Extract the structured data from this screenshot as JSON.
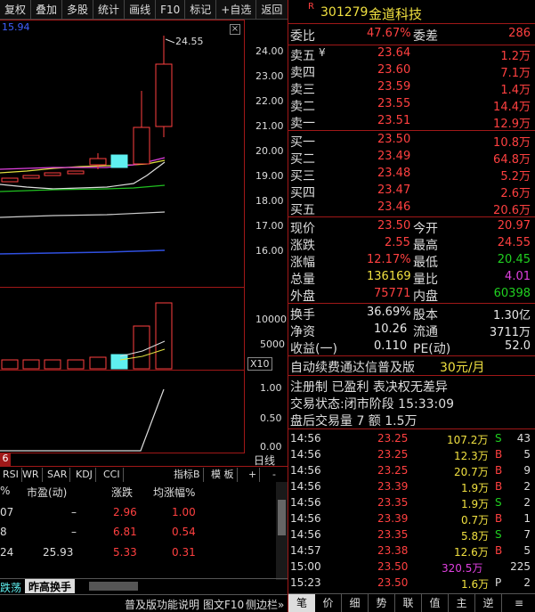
{
  "toolbar": [
    "复权",
    "叠加",
    "多股",
    "统计",
    "画线",
    "F10",
    "标记",
    "+自选",
    "返回"
  ],
  "chart": {
    "price_hint": "15.94",
    "peak_label": "24.55",
    "price_ticks": [
      "24.00",
      "23.00",
      "22.00",
      "21.00",
      "20.00",
      "19.00",
      "18.00",
      "17.00",
      "16.00"
    ],
    "vol_ticks": [
      "10000",
      "5000"
    ],
    "vol_unit": "X10",
    "ind_ticks": [
      "1.00",
      "0.50",
      "0.00"
    ],
    "date_label": "6",
    "period_label": "日线"
  },
  "indicator_tabs": [
    "RSI",
    "WR",
    "SAR",
    "KDJ",
    "CCI"
  ],
  "indicator_btns": [
    "指标B",
    "模 板",
    "+",
    "-"
  ],
  "sub_table": {
    "headers": [
      "%",
      "市盈(动)",
      "涨跌",
      "均涨幅%"
    ],
    "rows": [
      [
        "07",
        "–",
        "2.96",
        "1.00"
      ],
      [
        "8",
        "–",
        "6.81",
        "0.54"
      ],
      [
        "24",
        "25.93",
        "5.33",
        "0.31"
      ]
    ]
  },
  "bottom_tabs": [
    "跌荡",
    "昨高换手"
  ],
  "status_bar": [
    "普及版功能说明",
    "图文F10",
    "侧边栏»"
  ],
  "stock": {
    "badge": "R",
    "code": "301279",
    "name": "金道科技"
  },
  "wei": {
    "wb_label": "委比",
    "wb": "47.67%",
    "wc_label": "委差",
    "wc": "286"
  },
  "asks": [
    {
      "label": "卖五",
      "price": "23.64",
      "vol": "1.2万"
    },
    {
      "label": "卖四",
      "price": "23.60",
      "vol": "7.1万"
    },
    {
      "label": "卖三",
      "price": "23.59",
      "vol": "1.4万"
    },
    {
      "label": "卖二",
      "price": "23.55",
      "vol": "14.4万"
    },
    {
      "label": "卖一",
      "price": "23.51",
      "vol": "12.9万"
    }
  ],
  "bids": [
    {
      "label": "买一",
      "price": "23.50",
      "vol": "10.8万"
    },
    {
      "label": "买二",
      "price": "23.49",
      "vol": "64.8万"
    },
    {
      "label": "买三",
      "price": "23.48",
      "vol": "5.2万"
    },
    {
      "label": "买四",
      "price": "23.47",
      "vol": "2.6万"
    },
    {
      "label": "买五",
      "price": "23.46",
      "vol": "20.6万"
    }
  ],
  "quote": [
    {
      "l1": "现价",
      "v1": "23.50",
      "l2": "今开",
      "v2": "20.97"
    },
    {
      "l1": "涨跌",
      "v1": "2.55",
      "l2": "最高",
      "v2": "24.55"
    },
    {
      "l1": "涨幅",
      "v1": "12.17%",
      "l2": "最低",
      "v2": "20.45"
    },
    {
      "l1": "总量",
      "v1": "136169",
      "l2": "量比",
      "v2": "4.01"
    },
    {
      "l1": "外盘",
      "v1": "75771",
      "l2": "内盘",
      "v2": "60398"
    }
  ],
  "extra": [
    {
      "l1": "换手",
      "v1": "36.69%",
      "l2": "股本",
      "v2": "1.30亿"
    },
    {
      "l1": "净资",
      "v1": "10.26",
      "l2": "流通",
      "v2": "3711万"
    },
    {
      "l1": "收益(一)",
      "v1": "0.110",
      "l2": "PE(动)",
      "v2": "52.0"
    }
  ],
  "notice": {
    "text": "自动续费通达信普及版",
    "price": "30元/月"
  },
  "info": {
    "reg": "注册制 已盈利 表决权无差异",
    "status": "交易状态:闭市阶段 15:33:09",
    "after": "盘后交易量 7 额 1.5万"
  },
  "ticks": [
    {
      "t": "14:56",
      "p": "23.25",
      "v": "107.2万",
      "d": "S",
      "n": "43"
    },
    {
      "t": "14:56",
      "p": "23.25",
      "v": "12.3万",
      "d": "B",
      "n": "5"
    },
    {
      "t": "14:56",
      "p": "23.25",
      "v": "20.7万",
      "d": "B",
      "n": "9"
    },
    {
      "t": "14:56",
      "p": "23.39",
      "v": "1.9万",
      "d": "B",
      "n": "2"
    },
    {
      "t": "14:56",
      "p": "23.35",
      "v": "1.9万",
      "d": "S",
      "n": "2"
    },
    {
      "t": "14:56",
      "p": "23.39",
      "v": "0.7万",
      "d": "B",
      "n": "1"
    },
    {
      "t": "14:56",
      "p": "23.35",
      "v": "5.8万",
      "d": "S",
      "n": "7"
    },
    {
      "t": "14:57",
      "p": "23.38",
      "v": "12.6万",
      "d": "B",
      "n": "5"
    },
    {
      "t": "15:00",
      "p": "23.50",
      "v": "320.5万",
      "d": "",
      "n": "225"
    },
    {
      "t": "15:23",
      "p": "23.50",
      "v": "1.6万",
      "d": "P",
      "n": "2"
    }
  ],
  "right_tabs": [
    "笔",
    "价",
    "细",
    "势",
    "联",
    "值",
    "主",
    "逆",
    "≡"
  ]
}
